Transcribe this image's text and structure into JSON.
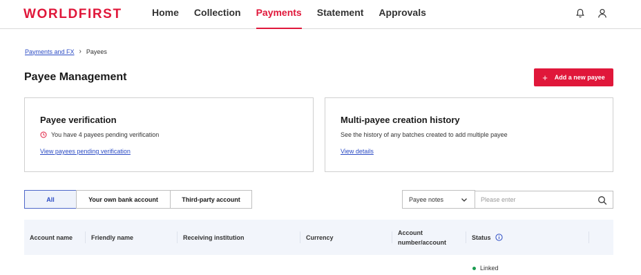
{
  "header": {
    "logo": "WORLDFIRST",
    "nav": [
      "Home",
      "Collection",
      "Payments",
      "Statement",
      "Approvals"
    ],
    "active_nav": "Payments",
    "icons": [
      "bell-icon",
      "user-icon"
    ]
  },
  "breadcrumb": {
    "parent": "Payments and FX",
    "current": "Payees"
  },
  "page": {
    "title": "Payee Management",
    "add_button": "Add a new payee"
  },
  "cards": {
    "verification": {
      "title": "Payee verification",
      "desc": "You have 4 payees pending verification",
      "link": "View payees pending verification"
    },
    "history": {
      "title": "Multi-payee creation history",
      "desc": "See the history of any batches created to add multiple payee",
      "link": "View details"
    }
  },
  "filters": {
    "tabs": [
      "All",
      "Your own bank account",
      "Third-party account"
    ],
    "active_tab": "All",
    "select_value": "Payee notes",
    "search_placeholder": "Please enter"
  },
  "table": {
    "columns": [
      "Account name",
      "Friendly name",
      "Receiving institution",
      "Currency",
      "Account number/account",
      "Status"
    ],
    "rows": [
      {
        "status": "Linked"
      }
    ]
  },
  "colors": {
    "brand": "#e0173a",
    "link": "#2b4bc4",
    "header_bg": "#f2f5fb",
    "linked": "#1a9b50"
  }
}
